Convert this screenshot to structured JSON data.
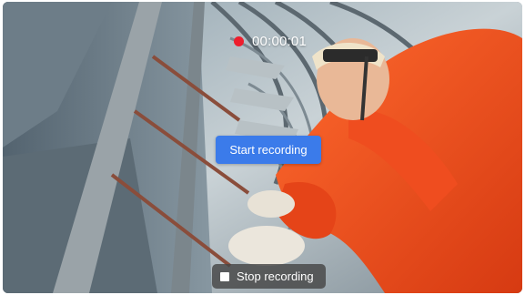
{
  "recording": {
    "timer": "00:00:01",
    "indicator_color": "#ee1e2d",
    "indicator_icon": "record-dot-icon"
  },
  "controls": {
    "start_label": "Start recording",
    "start_color": "#3b7bea",
    "stop_label": "Stop recording",
    "stop_icon": "stop-square-icon"
  }
}
